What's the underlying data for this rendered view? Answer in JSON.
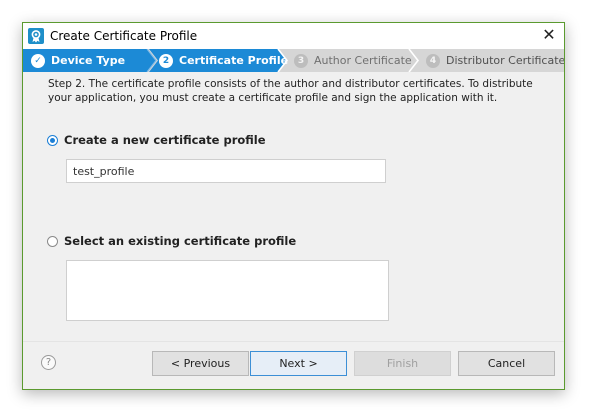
{
  "window": {
    "title": "Create Certificate Profile",
    "close_glyph": "✕"
  },
  "wizard": {
    "steps": [
      {
        "number": "✓",
        "label": "Device Type",
        "state": "completed"
      },
      {
        "number": "2",
        "label": "Certificate Profile",
        "state": "active"
      },
      {
        "number": "3",
        "label": "Author Certificate",
        "state": "pending"
      },
      {
        "number": "4",
        "label": "Distributor Certificate",
        "state": "pending"
      }
    ]
  },
  "description": "Step 2. The certificate profile consists of the author and distributor certificates. To distribute your application, you must create a certificate profile and sign the application with it.",
  "options": {
    "create_new": {
      "label": "Create a new certificate profile",
      "selected": true
    },
    "select_existing": {
      "label": "Select an existing certificate profile",
      "selected": false
    }
  },
  "profile_name": {
    "value": "test_profile"
  },
  "footer": {
    "help_glyph": "?",
    "previous_label": "< Previous",
    "next_label": "Next >",
    "finish_label": "Finish",
    "cancel_label": "Cancel"
  },
  "colors": {
    "active_step": "#1c8ad6",
    "window_border": "#5b9a2f",
    "app_icon": "#1f8fc9"
  }
}
